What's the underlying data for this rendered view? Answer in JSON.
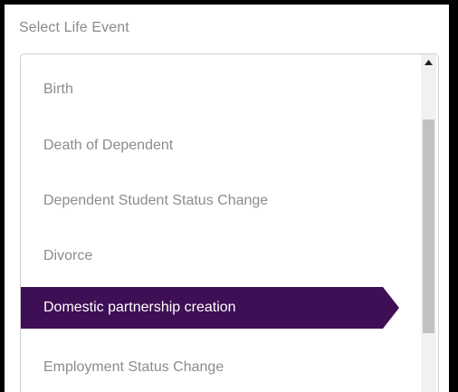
{
  "field": {
    "label": "Select Life Event"
  },
  "listbox": {
    "items": [
      {
        "label": "Birth",
        "selected": false
      },
      {
        "label": "Death of Dependent",
        "selected": false
      },
      {
        "label": "Dependent Student Status Change",
        "selected": false
      },
      {
        "label": "Divorce",
        "selected": false
      },
      {
        "label": "Domestic partnership creation",
        "selected": true
      },
      {
        "label": "Employment Status Change",
        "selected": false
      }
    ],
    "scrollbar": {
      "up_icon": "triangle-up-icon"
    }
  },
  "colors": {
    "selected_bg": "#3f0f55",
    "item_text": "#8c8c8c",
    "label_text": "#8a8a8a",
    "border": "#cfcfcf"
  }
}
